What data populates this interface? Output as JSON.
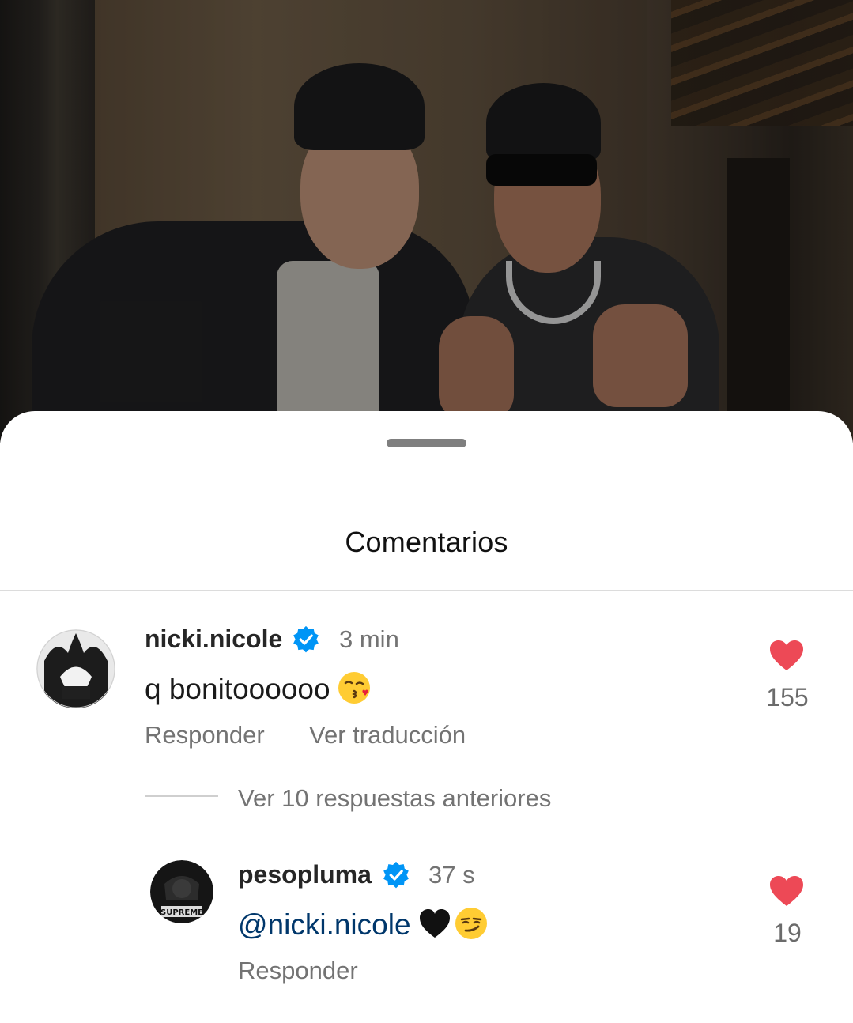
{
  "sheet": {
    "title": "Comentarios"
  },
  "comments": [
    {
      "username": "nicki.nicole",
      "verified": true,
      "time": "3 min",
      "text": "q bonitoooooo",
      "emoji": "kissing-face-emoji",
      "likes": "155",
      "actions": {
        "reply": "Responder",
        "translate": "Ver traducción"
      },
      "view_replies": "Ver 10 respuestas anteriores"
    }
  ],
  "replies": [
    {
      "username": "pesopluma",
      "verified": true,
      "time": "37 s",
      "mention": "@nicki.nicole",
      "emojis": [
        "black-heart-emoji",
        "smirking-face-emoji"
      ],
      "likes": "19",
      "actions": {
        "reply": "Responder"
      }
    }
  ],
  "colors": {
    "heart": "#ed4956",
    "verified": "#0095f6",
    "mention": "#00376b",
    "secondary_text": "#737373"
  }
}
